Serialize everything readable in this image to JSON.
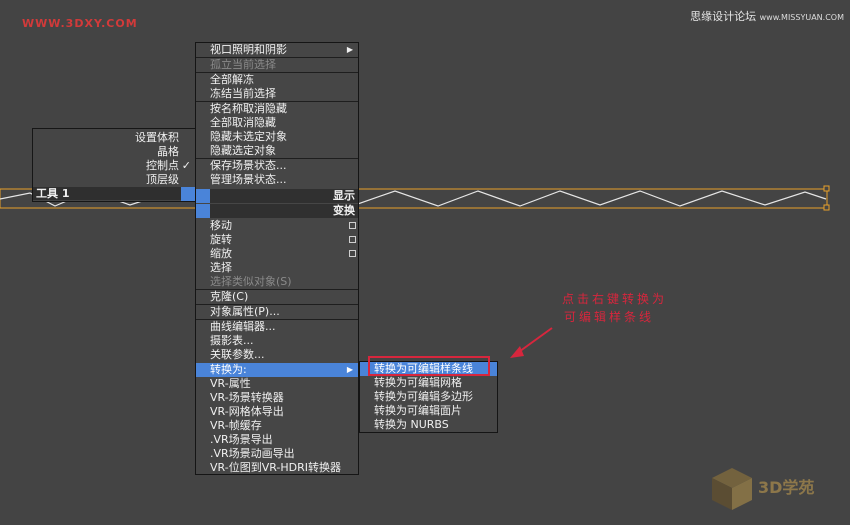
{
  "watermark_left": "WWW.3DXY.COM",
  "watermark_right": {
    "main": "思缘设计论坛",
    "sub": "www.MISSYUAN.COM"
  },
  "quad_left": {
    "items": [
      "设置体积",
      "晶格",
      "控制点",
      "顶层级"
    ],
    "checked": "✓",
    "tools_label": "工具 1"
  },
  "main_menu": {
    "lighting": "视口照明和阴影",
    "isolate": "孤立当前选择",
    "unfreeze_all": "全部解冻",
    "freeze": "冻结当前选择",
    "unhide_by_name": "按名称取消隐藏",
    "unhide_all": "全部取消隐藏",
    "hide_unselected": "隐藏未选定对象",
    "hide_selected": "隐藏选定对象",
    "save_scene_state": "保存场景状态...",
    "manage_scene_state": "管理场景状态...",
    "display_header": "显示",
    "transform_header": "变换",
    "move": "移动",
    "rotate": "旋转",
    "scale": "缩放",
    "select": "选择",
    "select_similar": "选择类似对象(S)",
    "clone": "克隆(C)",
    "object_properties": "对象属性(P)...",
    "curve_editor": "曲线编辑器...",
    "dope_sheet": "摄影表...",
    "wire_parameters": "关联参数...",
    "convert_to": "转换为:",
    "vr_props": "VR-属性",
    "vr_scene_converter": "VR-场景转换器",
    "vr_mesh_export": "VR-网格体导出",
    "vr_frame_buffer": "VR-帧缓存",
    "vr_scene_export": ".VR场景导出",
    "vr_anim_export": ".VR场景动画导出",
    "vr_bitmap_convert": "VR-位图到VR-HDRI转换器"
  },
  "sub_menu": {
    "to_spline": "转换为可编辑样条线",
    "to_mesh": "转换为可编辑网格",
    "to_poly": "转换为可编辑多边形",
    "to_patch": "转换为可编辑面片",
    "to_nurbs": "转换为 NURBS"
  },
  "annotation": {
    "line1": "点击右键转换为",
    "line2": "可编辑样条线"
  },
  "logo": {
    "text": "3D学苑"
  },
  "colors": {
    "highlight": "#4a84d9",
    "annotation": "#d7263d",
    "spline": "#e8a12a",
    "background": "#444444"
  }
}
